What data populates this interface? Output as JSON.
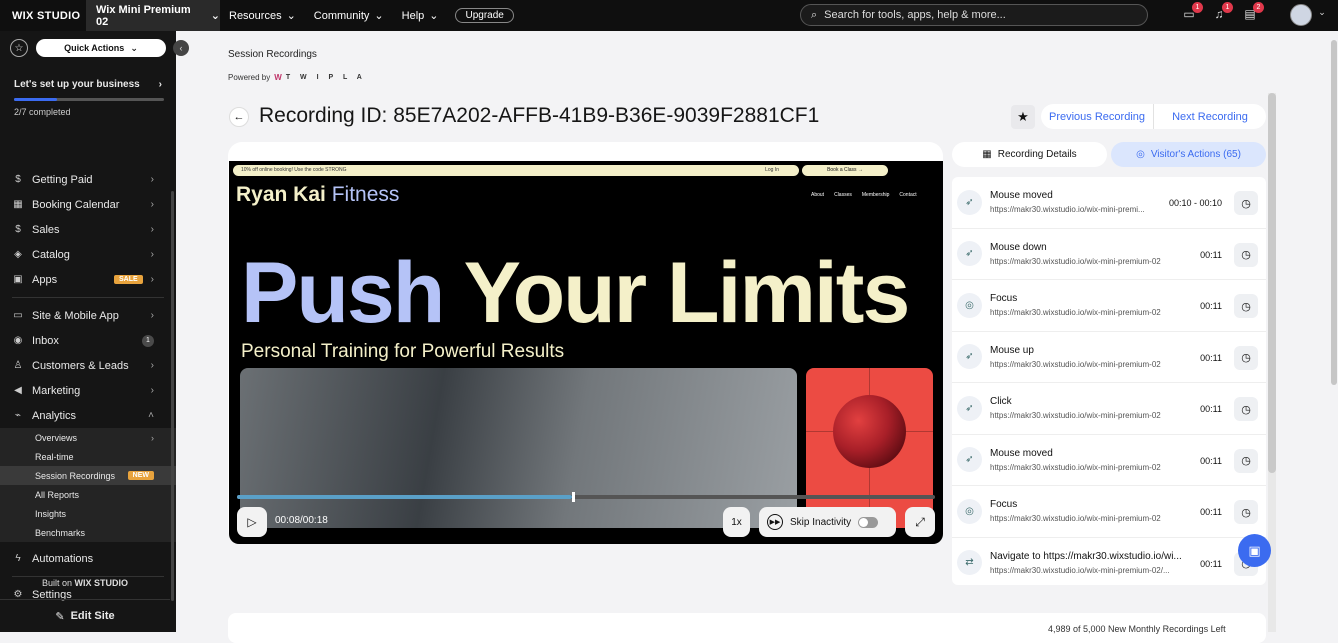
{
  "topbar": {
    "logo": "WIX STUDIO",
    "site_name": "Wix Mini Premium 02",
    "nav": [
      "Resources",
      "Community",
      "Help"
    ],
    "upgrade": "Upgrade",
    "search_placeholder": "Search for tools, apps, help & more...",
    "badges": {
      "chat": "1",
      "notifications": "1",
      "inbox": "2"
    }
  },
  "sidebar": {
    "quick_actions": "Quick Actions",
    "setup_title": "Let's set up your business",
    "setup_progress": 0.2857,
    "setup_status": "2/7 completed",
    "items_top": [
      {
        "label": "Getting Paid",
        "icon": "dollar-icon"
      },
      {
        "label": "Booking Calendar",
        "icon": "calendar-icon"
      },
      {
        "label": "Sales",
        "icon": "sales-icon"
      },
      {
        "label": "Catalog",
        "icon": "tag-icon"
      },
      {
        "label": "Apps",
        "icon": "apps-icon",
        "badge": "SALE"
      }
    ],
    "items_mid": [
      {
        "label": "Site & Mobile App",
        "icon": "monitor-icon"
      },
      {
        "label": "Inbox",
        "icon": "inbox-icon",
        "count": "1"
      },
      {
        "label": "Customers & Leads",
        "icon": "people-icon"
      },
      {
        "label": "Marketing",
        "icon": "megaphone-icon"
      }
    ],
    "analytics": {
      "label": "Analytics",
      "icon": "chart-icon"
    },
    "analytics_sub": [
      {
        "label": "Overviews",
        "chevron": true
      },
      {
        "label": "Real-time"
      },
      {
        "label": "Session Recordings",
        "badge": "NEW",
        "active": true
      },
      {
        "label": "All Reports"
      },
      {
        "label": "Insights"
      },
      {
        "label": "Benchmarks"
      }
    ],
    "automations": "Automations",
    "settings": "Settings",
    "built_on": "Built on",
    "built_on_brand": "WIX STUDIO",
    "edit_site": "Edit Site"
  },
  "main": {
    "section_title": "Session Recordings",
    "powered_by": "Powered by",
    "powered_brand": "T W I P L A",
    "recording_id": "Recording ID: 85E7A202-AFFB-41B9-B36E-9039F2881CF1",
    "previous": "Previous Recording",
    "next": "Next Recording",
    "quota": "4,989 of 5,000 New Monthly Recordings Left"
  },
  "video": {
    "promo": "10% off online booking! Use the code STRONG",
    "login": "Log In",
    "book": "Book a Class",
    "brand_a": "Ryan Kai",
    "brand_b": "Fitness",
    "site_nav": [
      "About",
      "Classes",
      "Membership",
      "Contact"
    ],
    "hero_a": "Push",
    "hero_b": "Your Limits",
    "hero_sub": "Personal Training for Powerful Results",
    "time": "00:08/00:18",
    "progress": 0.48,
    "speed": "1x",
    "skip_inactivity": "Skip Inactivity"
  },
  "tabs": {
    "details": "Recording Details",
    "actions": "Visitor's Actions (65)"
  },
  "actions": [
    {
      "title": "Mouse moved",
      "url": "https://makr30.wixstudio.io/wix-mini-premi...",
      "time": "00:10 - 00:10",
      "icon": "cursor-icon"
    },
    {
      "title": "Mouse down",
      "url": "https://makr30.wixstudio.io/wix-mini-premium-02",
      "time": "00:11",
      "icon": "cursor-icon"
    },
    {
      "title": "Focus",
      "url": "https://makr30.wixstudio.io/wix-mini-premium-02",
      "time": "00:11",
      "icon": "target-icon"
    },
    {
      "title": "Mouse up",
      "url": "https://makr30.wixstudio.io/wix-mini-premium-02",
      "time": "00:11",
      "icon": "cursor-icon"
    },
    {
      "title": "Click",
      "url": "https://makr30.wixstudio.io/wix-mini-premium-02",
      "time": "00:11",
      "icon": "cursor-icon"
    },
    {
      "title": "Mouse moved",
      "url": "https://makr30.wixstudio.io/wix-mini-premium-02",
      "time": "00:11",
      "icon": "cursor-icon"
    },
    {
      "title": "Focus",
      "url": "https://makr30.wixstudio.io/wix-mini-premium-02",
      "time": "00:11",
      "icon": "target-icon"
    },
    {
      "title": "Navigate to https://makr30.wixstudio.io/wi...",
      "url": "https://makr30.wixstudio.io/wix-mini-premium-02/...",
      "time": "00:11",
      "icon": "navigate-icon"
    }
  ],
  "colors": {
    "accent": "#3b6bf0",
    "sidebar": "#151515",
    "topbar": "#0f0f0f",
    "sale": "#e8a33d"
  }
}
